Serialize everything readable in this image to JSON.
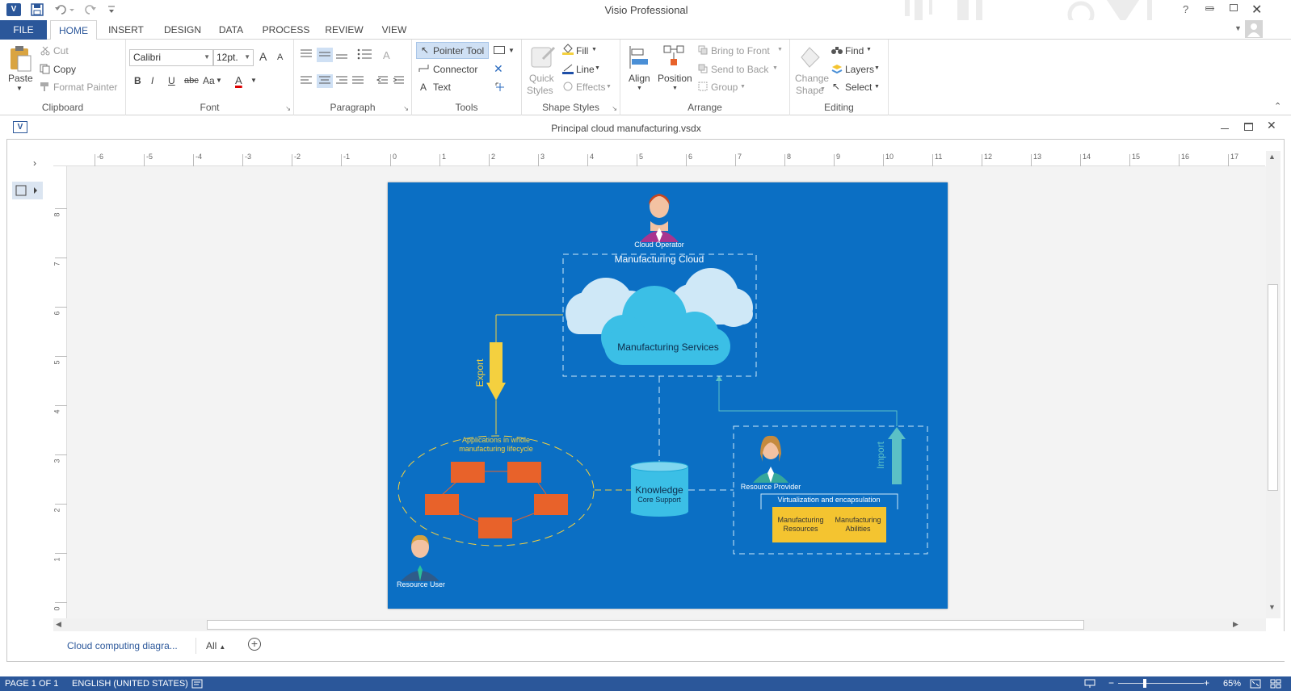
{
  "app_title": "Visio Professional",
  "tabs": {
    "file": "FILE",
    "home": "HOME",
    "insert": "INSERT",
    "design": "DESIGN",
    "data": "DATA",
    "process": "PROCESS",
    "review": "REVIEW",
    "view": "VIEW"
  },
  "clipboard": {
    "paste": "Paste",
    "cut": "Cut",
    "copy": "Copy",
    "format_painter": "Format Painter",
    "label": "Clipboard"
  },
  "font": {
    "family": "Calibri",
    "size": "12pt.",
    "bold": "B",
    "italic": "I",
    "underline": "U",
    "strike": "abc",
    "case": "Aa",
    "color_letter": "A",
    "grow": "A",
    "shrink": "A",
    "label": "Font"
  },
  "paragraph": {
    "label": "Paragraph"
  },
  "tools": {
    "pointer": "Pointer Tool",
    "connector": "Connector",
    "text": "Text",
    "label": "Tools"
  },
  "shape_styles": {
    "quick": "Quick",
    "styles": "Styles",
    "fill": "Fill",
    "line": "Line",
    "effects": "Effects",
    "label": "Shape Styles"
  },
  "arrange": {
    "align": "Align",
    "position": "Position",
    "bring_front": "Bring to Front",
    "send_back": "Send to Back",
    "group": "Group",
    "label": "Arrange"
  },
  "editing": {
    "change": "Change",
    "shape": "Shape",
    "find": "Find",
    "layers": "Layers",
    "select": "Select",
    "label": "Editing"
  },
  "document": {
    "title": "Principal cloud manufacturing.vsdx"
  },
  "ruler": {
    "h_ticks": [
      "-6",
      "-5",
      "-4",
      "-3",
      "-2",
      "-1",
      "0",
      "1",
      "2",
      "3",
      "4",
      "5",
      "6",
      "7",
      "8",
      "9",
      "10",
      "11",
      "12",
      "13",
      "14",
      "15",
      "16",
      "17"
    ],
    "v_ticks": [
      "8",
      "7",
      "6",
      "5",
      "4",
      "3",
      "2",
      "1",
      "0"
    ]
  },
  "diagram": {
    "cloud_operator": "Cloud Operator",
    "manufacturing_cloud": "Manufacturing Cloud",
    "manufacturing_services": "Manufacturing Services",
    "export": "Export",
    "import": "Import",
    "applications": "Applications in whole",
    "applications2": "manufacturing lifecycle",
    "knowledge": "Knowledge",
    "core_support": "Core Support",
    "resource_provider": "Resource Provider",
    "virtualization": "Virtualization and encapsulation",
    "mfg_resources_1": "Manufacturing",
    "mfg_resources_2": "Resources",
    "mfg_abilities_1": "Manufacturing",
    "mfg_abilities_2": "Abilities",
    "resource_user": "Resource User",
    "colors": {
      "page": "#0b6fc4",
      "yellow": "#f4d03f",
      "orange": "#e8622a",
      "cloud": "#3bbfe6",
      "cloud_light": "#cfe8f7",
      "teal": "#5bc0c6",
      "box_yellow": "#f4c430"
    }
  },
  "page_tabs": {
    "current": "Cloud computing diagra...",
    "all": "All"
  },
  "status": {
    "page": "PAGE 1 OF 1",
    "language": "ENGLISH (UNITED STATES)",
    "zoom": "65%"
  }
}
